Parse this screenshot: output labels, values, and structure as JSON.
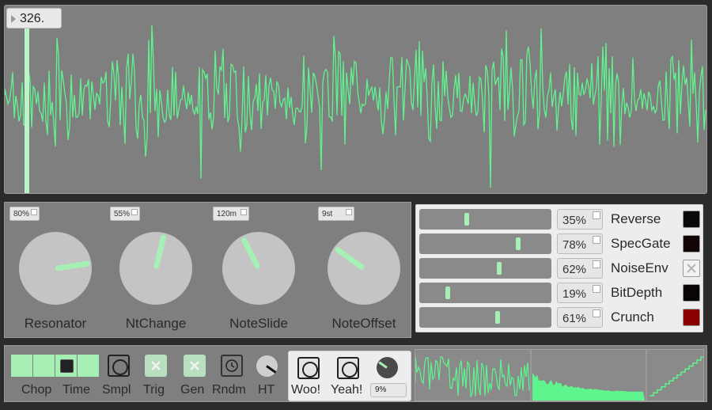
{
  "colors": {
    "accent": "#5ff58e",
    "panel": "#7f7f7f",
    "knob": "#c4c4c4",
    "indicator": "#a6f0b6",
    "crunch_on": "#8a0000"
  },
  "waveform": {
    "playhead_value": "326."
  },
  "knobs": [
    {
      "label": "Resonator",
      "value": "80%",
      "level": 0.8
    },
    {
      "label": "NtChange",
      "value": "55%",
      "level": 0.55
    },
    {
      "label": "NoteSlide",
      "value": "120m",
      "level": 0.4
    },
    {
      "label": "NoteOffset",
      "value": "9st",
      "level": 0.3
    }
  ],
  "sliders": [
    {
      "label": "Reverse",
      "value": "35%",
      "level": 0.35,
      "toggle": "off-dark"
    },
    {
      "label": "SpecGate",
      "value": "78%",
      "level": 0.78,
      "toggle": "off-dark"
    },
    {
      "label": "NoiseEnv",
      "value": "62%",
      "level": 0.62,
      "toggle": "x"
    },
    {
      "label": "BitDepth",
      "value": "19%",
      "level": 0.19,
      "toggle": "off-dark"
    },
    {
      "label": "Crunch",
      "value": "61%",
      "level": 0.61,
      "toggle": "on-red"
    }
  ],
  "bottom": {
    "chop_label": "Chop",
    "time_label": "Time",
    "smpl_label": "Smpl",
    "trig_label": "Trig",
    "gen_label": "Gen",
    "rndm_label": "Rndm",
    "ht_label": "HT",
    "woo_label": "Woo!",
    "yeah_label": "Yeah!",
    "mix_value": "9%"
  },
  "icons": {
    "close": "x-icon",
    "clock": "clock-icon",
    "circle": "circle-icon"
  }
}
